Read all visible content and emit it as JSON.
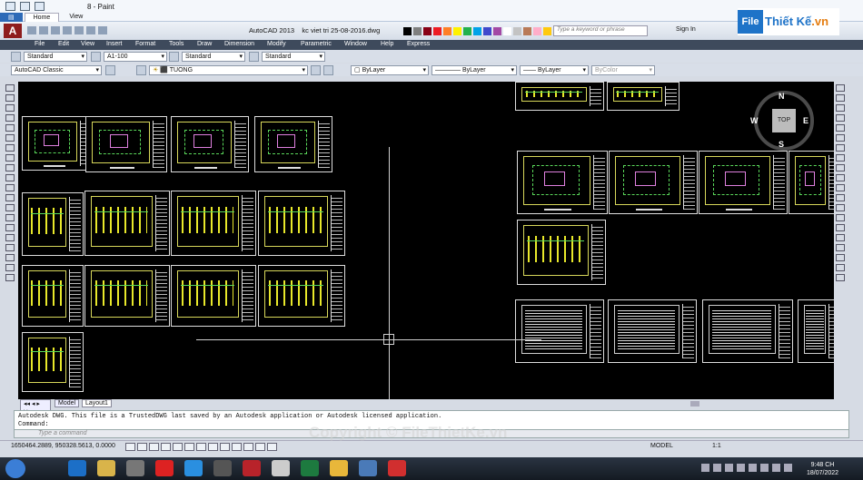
{
  "paint": {
    "title": "8 - Paint",
    "tabs": [
      "Home",
      "View"
    ]
  },
  "logo": {
    "brand_prefix": "File",
    "brand_name": "Thiết Kế",
    "brand_suffix": ".vn"
  },
  "autocad": {
    "app_name": "AutoCAD 2013",
    "file_name": "kc viet tri 25-08-2016.dwg",
    "search_placeholder": "Type a keyword or phrase",
    "sign_in": "Sign In",
    "menu": [
      "File",
      "Edit",
      "View",
      "Insert",
      "Format",
      "Tools",
      "Draw",
      "Dimension",
      "Modify",
      "Parametric",
      "Window",
      "Help",
      "Express"
    ],
    "row1": {
      "text_style": "Standard",
      "dim_style": "A1-100",
      "table_style": "Standard",
      "mleader_style": "Standard"
    },
    "row2": {
      "workspace": "AutoCAD Classic",
      "layer": "TUONG",
      "color": "ByLayer",
      "linetype": "ByLayer",
      "lineweight": "ByLayer",
      "plotstyle": "ByColor"
    },
    "viewcube": {
      "top": "TOP",
      "north": "N",
      "south": "S",
      "east": "E",
      "west": "W"
    },
    "layout_tabs": [
      "Model",
      "Layout1"
    ],
    "command_history": "Autodesk DWG.  This file is a TrustedDWG last saved by an Autodesk application or Autodesk licensed application.",
    "command_label": "Command:",
    "command_placeholder": "Type a command",
    "coords": "1650464.2889, 950328.5613, 0.0000",
    "model_label": "MODEL",
    "scale": "1:1"
  },
  "watermark": "Copyright © FileThietKe.vn",
  "taskbar": {
    "time": "9:48 CH",
    "date": "18/07/2022"
  },
  "colors": {
    "canvas": "#000000",
    "menubar": "#3e4a5c",
    "plan_lines": "#d8d85a",
    "accent": "#1e73c8"
  }
}
